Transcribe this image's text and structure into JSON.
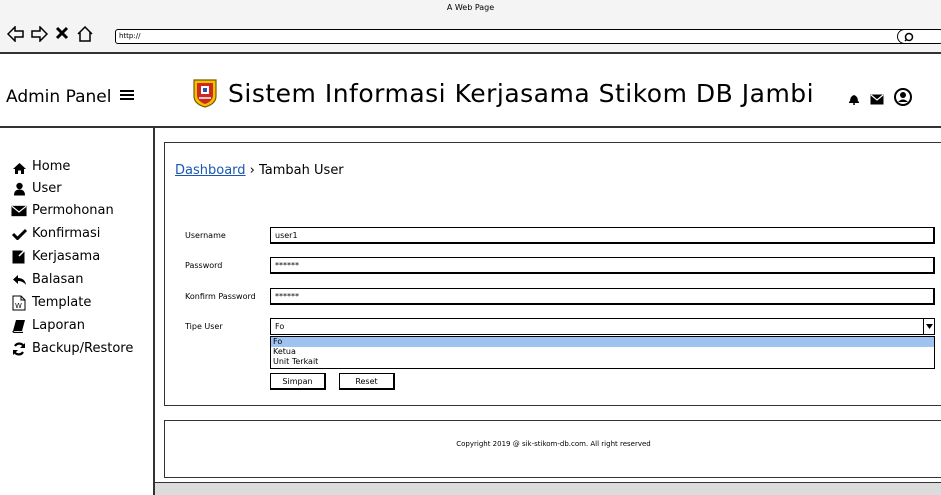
{
  "browser": {
    "page_title": "A Web Page",
    "url": "http://",
    "nav_icons": [
      "back-arrow-icon",
      "forward-arrow-icon",
      "close-icon",
      "home-icon"
    ]
  },
  "header": {
    "admin_panel_label": "Admin Panel",
    "site_title": "Sistem Informasi Kerjasama Stikom DB Jambi",
    "icons": [
      "bell-icon",
      "envelope-icon",
      "user-circle-icon"
    ]
  },
  "sidebar": {
    "items": [
      {
        "label": "Home",
        "icon": "home-icon"
      },
      {
        "label": "User",
        "icon": "user-icon"
      },
      {
        "label": "Permohonan",
        "icon": "envelope-icon"
      },
      {
        "label": "Konfirmasi",
        "icon": "check-icon"
      },
      {
        "label": "Kerjasama",
        "icon": "share-icon"
      },
      {
        "label": "Balasan",
        "icon": "reply-icon"
      },
      {
        "label": "Template",
        "icon": "word-document-icon"
      },
      {
        "label": "Laporan",
        "icon": "book-icon"
      },
      {
        "label": "Backup/Restore",
        "icon": "refresh-icon"
      }
    ]
  },
  "breadcrumb": {
    "link": "Dashboard",
    "separator": "›",
    "current": "Tambah User"
  },
  "form": {
    "username_label": "Username",
    "username_value": "user1",
    "password_label": "Password",
    "password_value": "******",
    "confirm_label": "Konfirm Password",
    "confirm_value": "******",
    "type_label": "Tipe User",
    "type_value": "Fo",
    "type_options": [
      "Fo",
      "Ketua",
      "Unit Terkait"
    ],
    "save_label": "Simpan",
    "reset_label": "Reset"
  },
  "footer": {
    "copyright": "Copyright 2019 @ sik-stikom-db.com. All right reserved"
  }
}
